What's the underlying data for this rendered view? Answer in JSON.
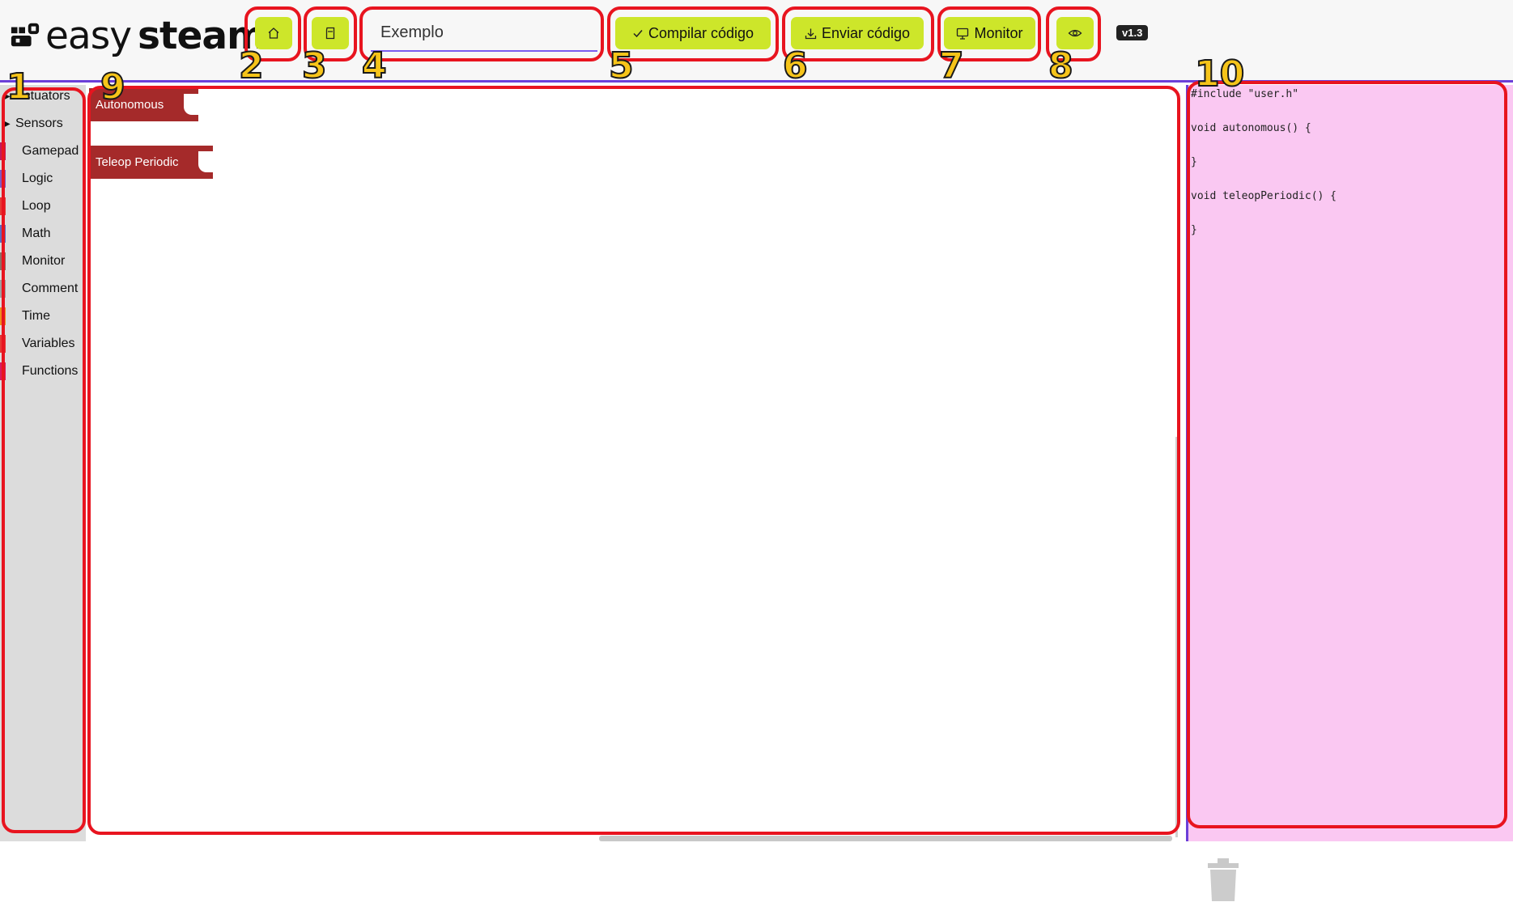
{
  "app": {
    "logo_easy": "easy",
    "logo_steam": "steam",
    "version": "v1.3"
  },
  "header": {
    "home_icon": "home-icon",
    "save_icon": "sd-card-icon",
    "project_name": "Exemplo",
    "compile_label": "Compilar código",
    "compile_icon": "check-icon",
    "upload_label": "Enviar código",
    "upload_icon": "download-icon",
    "monitor_label": "Monitor",
    "monitor_icon": "monitor-icon",
    "view_icon": "eye-icon",
    "accent_color": "#cde62a"
  },
  "toolbox": {
    "items": [
      {
        "label": "Actuators",
        "expandable": true,
        "color": ""
      },
      {
        "label": "Sensors",
        "expandable": true,
        "color": ""
      },
      {
        "label": "Gamepad",
        "expandable": false,
        "color": "#c2185b"
      },
      {
        "label": "Logic",
        "expandable": false,
        "color": "#7e57c2"
      },
      {
        "label": "Loop",
        "expandable": false,
        "color": "#e53935"
      },
      {
        "label": "Math",
        "expandable": false,
        "color": "#5c6bc0"
      },
      {
        "label": "Monitor",
        "expandable": false,
        "color": "#8d6e63"
      },
      {
        "label": "Comment",
        "expandable": false,
        "color": "#9e9e9e"
      },
      {
        "label": "Time",
        "expandable": false,
        "color": "#ef8c1a"
      },
      {
        "label": "Variables",
        "expandable": false,
        "color": "#e53935"
      },
      {
        "label": "Functions",
        "expandable": false,
        "color": "#d81b60"
      }
    ]
  },
  "workspace": {
    "blocks": [
      {
        "label": "Autonomous",
        "color": "#a52a2a"
      },
      {
        "label": "Teleop Periodic",
        "color": "#a52a2a"
      }
    ],
    "trash_icon": "trash-icon"
  },
  "code": {
    "lines": [
      "#include \"user.h\"",
      "",
      "void autonomous() {",
      "",
      "}",
      "",
      "void teleopPeriodic() {",
      "",
      "}"
    ],
    "background": "#fac8f2"
  },
  "annotations": [
    "1",
    "2",
    "3",
    "4",
    "5",
    "6",
    "7",
    "8",
    "9",
    "10"
  ]
}
